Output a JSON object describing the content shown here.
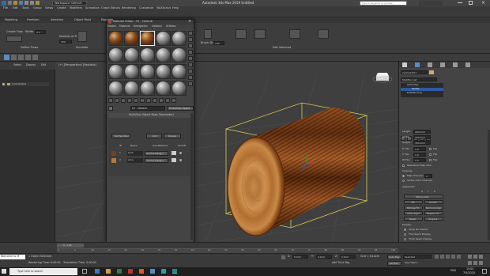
{
  "app": {
    "title": "Autodesk 3ds Max 2019    Untitled",
    "workspace": "Workspace: Default",
    "search_placeholder": "Type a keyword or phrase"
  },
  "menu": [
    "File",
    "Edit",
    "Tools",
    "Group",
    "Views",
    "Create",
    "Modifiers",
    "Animation",
    "Graph Editors",
    "Rendering",
    "Customize",
    "MAXScript",
    "Help"
  ],
  "ribbon": {
    "tabs": [
      "Modeling",
      "Freeform",
      "Selection",
      "Object Paint",
      "Populate"
    ],
    "groups": {
      "define_flows": "Define Flows",
      "simulate": "Simulate",
      "edit_selected": "Edit Selected",
      "create_flow": "Create Flow",
      "width": "Width",
      "number_of_frames": "Number of Frames",
      "frames_value": "300",
      "width_value": "0.1",
      "brush_size": "Brush Size",
      "brush_value": "100"
    }
  },
  "scene_explorer": {
    "tabs": [
      "Select",
      "Display",
      "Edit"
    ],
    "items": [
      "Cylinder001"
    ]
  },
  "viewport": {
    "label": "[+] [Perspective] [Realistic]"
  },
  "material_editor": {
    "title": "Material Editor - 01 - Default",
    "menu": [
      "Modes",
      "Material",
      "Navigation",
      "Options",
      "Utilities"
    ],
    "material_name": "01 - Default",
    "material_type": "Multi/Sub-Object",
    "rollout_title": "Multi/Sub-Object Basic Parameters",
    "buttons": {
      "set_number": "Set Number",
      "add": "Add",
      "delete": "Delete"
    },
    "columns": {
      "id": "ID",
      "name": "Name",
      "sub_material": "Sub-Material",
      "on_off": "On/Off"
    },
    "rows": [
      {
        "id": "1",
        "name": "bark",
        "sub": "(Arch & Design)"
      },
      {
        "id": "2",
        "name": "slice",
        "sub": "(Arch & Design)"
      }
    ]
  },
  "command_panel": {
    "object_name": "Cylinder001",
    "modifier_list": "Modifier List",
    "stack": [
      "UVW Map",
      "Gizmo",
      "Cylinder",
      "Editable Poly"
    ],
    "params": [
      {
        "label": "Length",
        "value": "200.0cm"
      },
      {
        "label": "Width",
        "value": "200.0cm"
      },
      {
        "label": "Height",
        "value": "350.0cm"
      },
      {
        "label": "U Tile",
        "value": "1.0"
      },
      {
        "label": "V Tile",
        "value": "1.0"
      },
      {
        "label": "W Tile",
        "value": "1.0"
      }
    ],
    "flip": "Flip",
    "real_world": "Real-World Map Size",
    "channel_title": "Channel:",
    "map_channel": "Map Channel:",
    "map_channel_value": "1",
    "vertex_color": "Vertex Color Channel",
    "alignment": "Alignment:",
    "axes": [
      "X",
      "Y",
      "Z"
    ],
    "manipulate": "Manipulate",
    "fit": "Fit",
    "center": "Center",
    "bitmap_fit": "Bitmap Fit",
    "normal_align": "Normal Align",
    "view_align": "View Align",
    "region_fit": "Region Fit",
    "reset": "Reset",
    "acquire": "Acquire",
    "display": "Display:",
    "show_no_seams": "Show No Seams",
    "thin_seam": "Thin Seam Display",
    "thick_seam": "Thick Seam Display"
  },
  "timeline": {
    "frame": "0 / 100",
    "ticks": [
      "0",
      "5",
      "10",
      "15",
      "20",
      "25",
      "30",
      "35",
      "40",
      "45",
      "50",
      "55",
      "60",
      "65",
      "70",
      "75",
      "80",
      "85",
      "90",
      "95",
      "100"
    ]
  },
  "status": {
    "objects_selected": "1 Object Selected",
    "rendering_time": "Rendering Time: 0:00:01",
    "translation_time": "Translation Time: 0:00:02",
    "welcome": "Welcome to M",
    "add_time_tag": "Add Time Tag",
    "auto_key": "Auto Key",
    "selected": "Selected",
    "set_key": "Set Key",
    "key_filters": "Key Filters...",
    "x_label": "X:",
    "y_label": "Y:",
    "z_label": "Z:",
    "grid": "Grid = 10.0cm",
    "x_value": "0.0cm",
    "y_value": "0.0cm",
    "z_value": "0.0cm"
  },
  "taskbar": {
    "search_placeholder": "Type here to search",
    "time": "15:04",
    "date": "7/5/2020",
    "lang": "ENG"
  },
  "colors": {
    "accent": "#5b8bc7",
    "selection": "#2e5aa0",
    "gizmo": "#e0d060"
  }
}
